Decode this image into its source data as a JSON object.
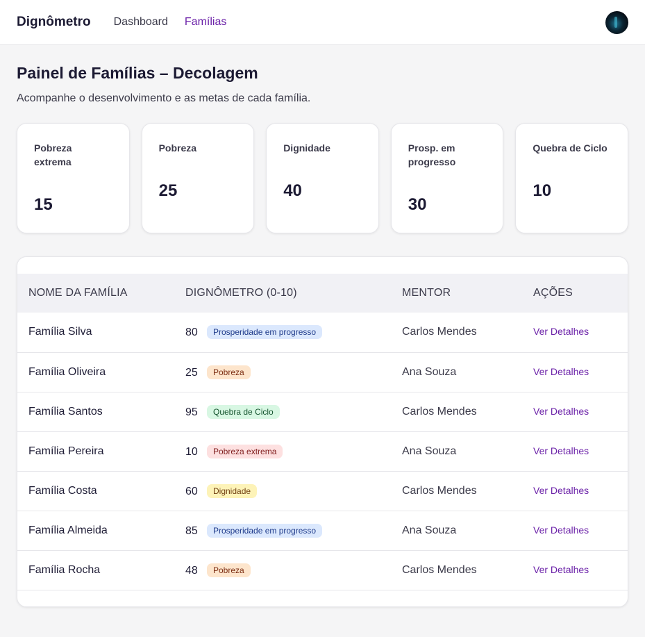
{
  "header": {
    "brand": "Dignômetro",
    "nav": [
      {
        "label": "Dashboard",
        "active": false
      },
      {
        "label": "Famílias",
        "active": true
      }
    ]
  },
  "page": {
    "title": "Painel de Famílias – Decolagem",
    "subtitle": "Acompanhe o desenvolvimento e as metas de cada família."
  },
  "stats": [
    {
      "label": "Pobreza extrema",
      "value": "15"
    },
    {
      "label": "Pobreza",
      "value": "25"
    },
    {
      "label": "Dignidade",
      "value": "40"
    },
    {
      "label": "Prosp. em progresso",
      "value": "30"
    },
    {
      "label": "Quebra de Ciclo",
      "value": "10"
    }
  ],
  "table": {
    "headers": [
      "NOME DA FAMÍLIA",
      "DIGNÔMETRO (0-10)",
      "MENTOR",
      "AÇÕES"
    ],
    "rows": [
      {
        "name": "Família Silva",
        "score": "80",
        "badge": "Prosperidade em progresso",
        "mentor": "Carlos Mendes",
        "action": "Ver Detalhes"
      },
      {
        "name": "Família Oliveira",
        "score": "25",
        "badge": "Pobreza",
        "mentor": "Ana Souza",
        "action": "Ver Detalhes"
      },
      {
        "name": "Família Santos",
        "score": "95",
        "badge": "Quebra de Ciclo",
        "mentor": "Carlos Mendes",
        "action": "Ver Detalhes"
      },
      {
        "name": "Família Pereira",
        "score": "10",
        "badge": "Pobreza extrema",
        "mentor": "Ana Souza",
        "action": "Ver Detalhes"
      },
      {
        "name": "Família Costa",
        "score": "60",
        "badge": "Dignidade",
        "mentor": "Carlos Mendes",
        "action": "Ver Detalhes"
      },
      {
        "name": "Família Almeida",
        "score": "85",
        "badge": "Prosperidade em progresso",
        "mentor": "Ana Souza",
        "action": "Ver Detalhes"
      },
      {
        "name": "Família Rocha",
        "score": "48",
        "badge": "Pobreza",
        "mentor": "Carlos Mendes",
        "action": "Ver Detalhes"
      }
    ]
  },
  "colors": {
    "accent": "#6b21a8",
    "badge_prosperidade": "#dbe8fd",
    "badge_pobreza": "#fde5cc",
    "badge_quebra": "#d8f7e3",
    "badge_extrema": "#fde0e0",
    "badge_dignidade": "#fdf3b8"
  }
}
